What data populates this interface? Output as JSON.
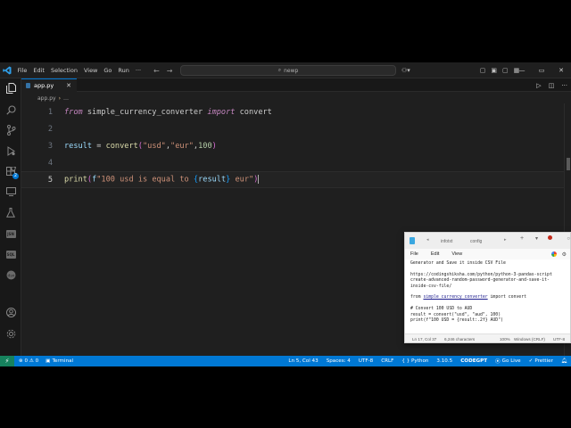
{
  "titlebar": {
    "menu": [
      "File",
      "Edit",
      "Selection",
      "View",
      "Go",
      "Run"
    ],
    "more": "···",
    "search_text": "newp"
  },
  "tab": {
    "filename": "app.py",
    "close": "✕"
  },
  "breadcrumb": {
    "file": "app.py",
    "symbol": "…"
  },
  "editor": {
    "lines": [
      {
        "num": "1",
        "tokens": [
          [
            "kw",
            "from"
          ],
          [
            "plain",
            " simple_currency_converter "
          ],
          [
            "kw",
            "import"
          ],
          [
            "plain",
            " convert"
          ]
        ]
      },
      {
        "num": "2",
        "tokens": []
      },
      {
        "num": "3",
        "tokens": [
          [
            "var",
            "result"
          ],
          [
            "plain",
            " = "
          ],
          [
            "fn",
            "convert"
          ],
          [
            "brk",
            "("
          ],
          [
            "str",
            "\"usd\""
          ],
          [
            "plain",
            ","
          ],
          [
            "str",
            "\"eur\""
          ],
          [
            "plain",
            ","
          ],
          [
            "num",
            "100"
          ],
          [
            "brk",
            ")"
          ]
        ]
      },
      {
        "num": "4",
        "tokens": []
      },
      {
        "num": "5",
        "tokens": [
          [
            "fn",
            "print"
          ],
          [
            "brk",
            "("
          ],
          [
            "var",
            "f"
          ],
          [
            "str",
            "\"100 usd is equal to "
          ],
          [
            "brk2",
            "{"
          ],
          [
            "var",
            "result"
          ],
          [
            "brk2",
            "}"
          ],
          [
            "str",
            " eur\""
          ],
          [
            "brk",
            ")"
          ]
        ]
      }
    ]
  },
  "statusbar": {
    "remote": "⚡",
    "problems": "⊗ 0 ⚠ 0",
    "terminal": "Terminal",
    "position": "Ln 5, Col 43",
    "spaces": "Spaces: 4",
    "encoding": "UTF-8",
    "eol": "CRLF",
    "language": "Python",
    "python_version": "3.10.5",
    "extension": "CODEGPT",
    "go_live": "Go Live",
    "prettier": "Prettier"
  },
  "notepad": {
    "tabs": [
      "infotxt",
      "config"
    ],
    "menu": [
      "File",
      "Edit",
      "View"
    ],
    "body_lines": [
      "Generator and Save it inside CSV File",
      "",
      "https://codingshiksha.com/python/python-3-pandas-script",
      "create-advanced-random-password-generator-and-save-it-",
      "inside-csv-file/",
      "",
      "",
      "# Convert 100 USD to AUD",
      "result = convert(\"usd\", \"aud\", 100)",
      "print(f\"100 USD = {result:.2f} AUD\")"
    ],
    "import_prefix": "from ",
    "import_module": "simple_currency_converter",
    "import_suffix": " import convert",
    "status": {
      "position": "Ln 17, Col 37",
      "chars": "6,246 characters",
      "zoom": "100%",
      "eol": "Windows (CRLF)",
      "encoding": "UTF-8"
    }
  }
}
